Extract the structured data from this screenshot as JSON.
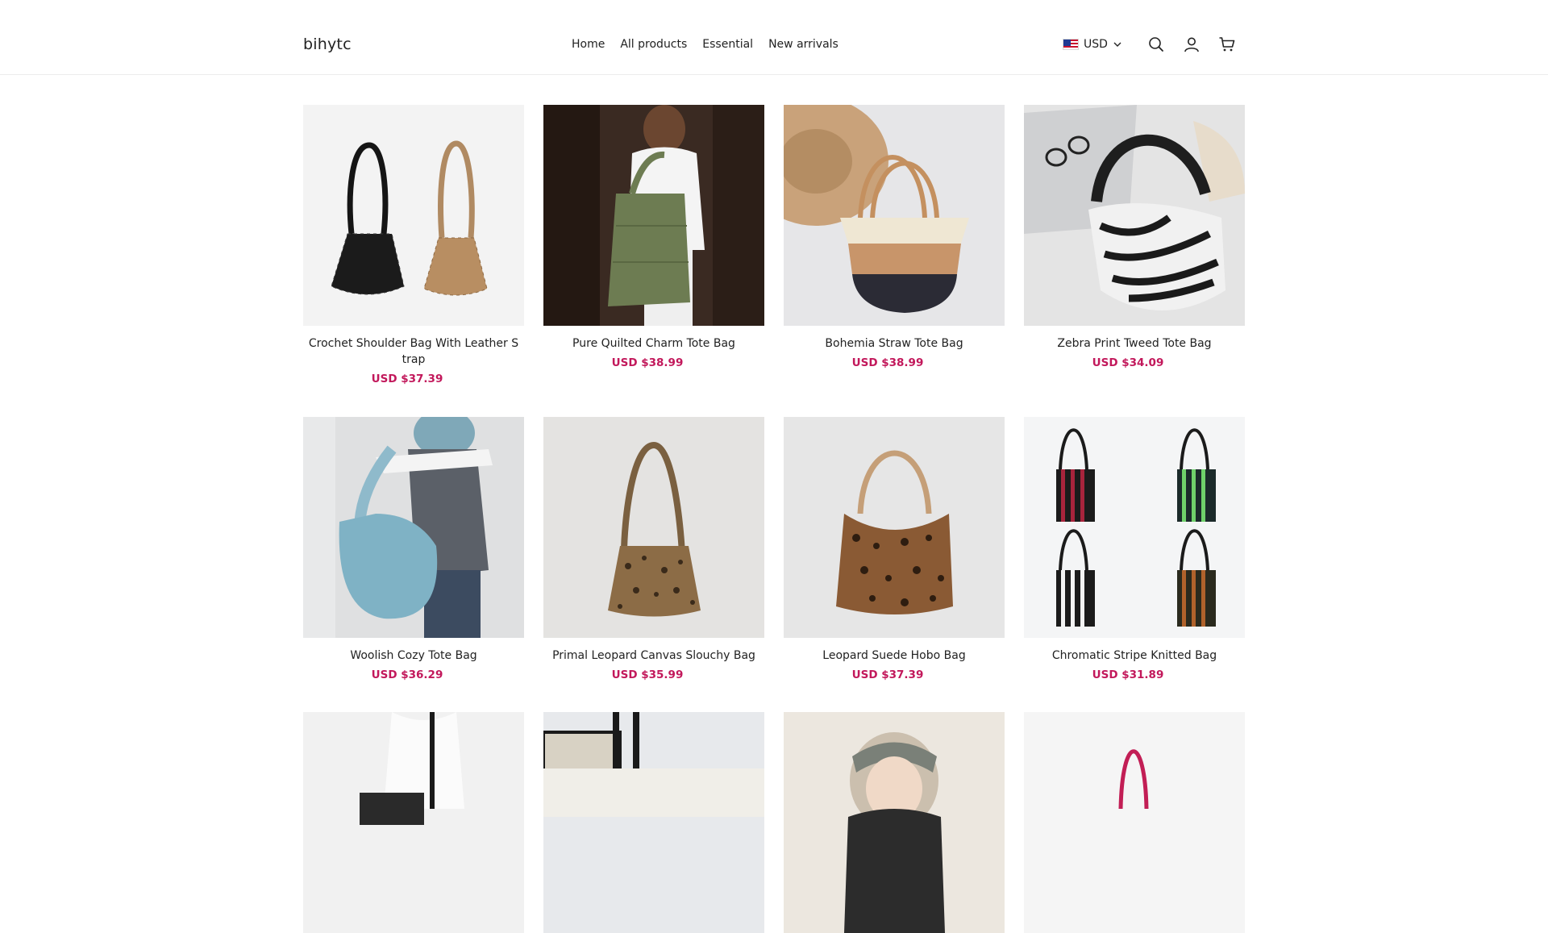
{
  "brand": {
    "name": "bihytc"
  },
  "nav": {
    "items": [
      "Home",
      "All products",
      "Essential",
      "New arrivals"
    ]
  },
  "currency": {
    "code": "USD",
    "flag": "us-flag-icon"
  },
  "header_icons": [
    "search-icon",
    "account-icon",
    "cart-icon"
  ],
  "colors": {
    "price": "#c2185b",
    "text": "#222222",
    "border": "#ececec"
  },
  "products": [
    {
      "title": "Crochet Shoulder Bag With Leather Strap",
      "price": "USD $37.39"
    },
    {
      "title": "Pure Quilted Charm Tote Bag",
      "price": "USD $38.99"
    },
    {
      "title": "Bohemia Straw Tote Bag",
      "price": "USD $38.99"
    },
    {
      "title": "Zebra Print Tweed Tote Bag",
      "price": "USD $34.09"
    },
    {
      "title": "Woolish Cozy Tote Bag",
      "price": "USD $36.29"
    },
    {
      "title": "Primal Leopard Canvas Slouchy Bag",
      "price": "USD $35.99"
    },
    {
      "title": "Leopard Suede Hobo Bag",
      "price": "USD $37.39"
    },
    {
      "title": "Chromatic Stripe Knitted Bag",
      "price": "USD $31.89"
    }
  ]
}
